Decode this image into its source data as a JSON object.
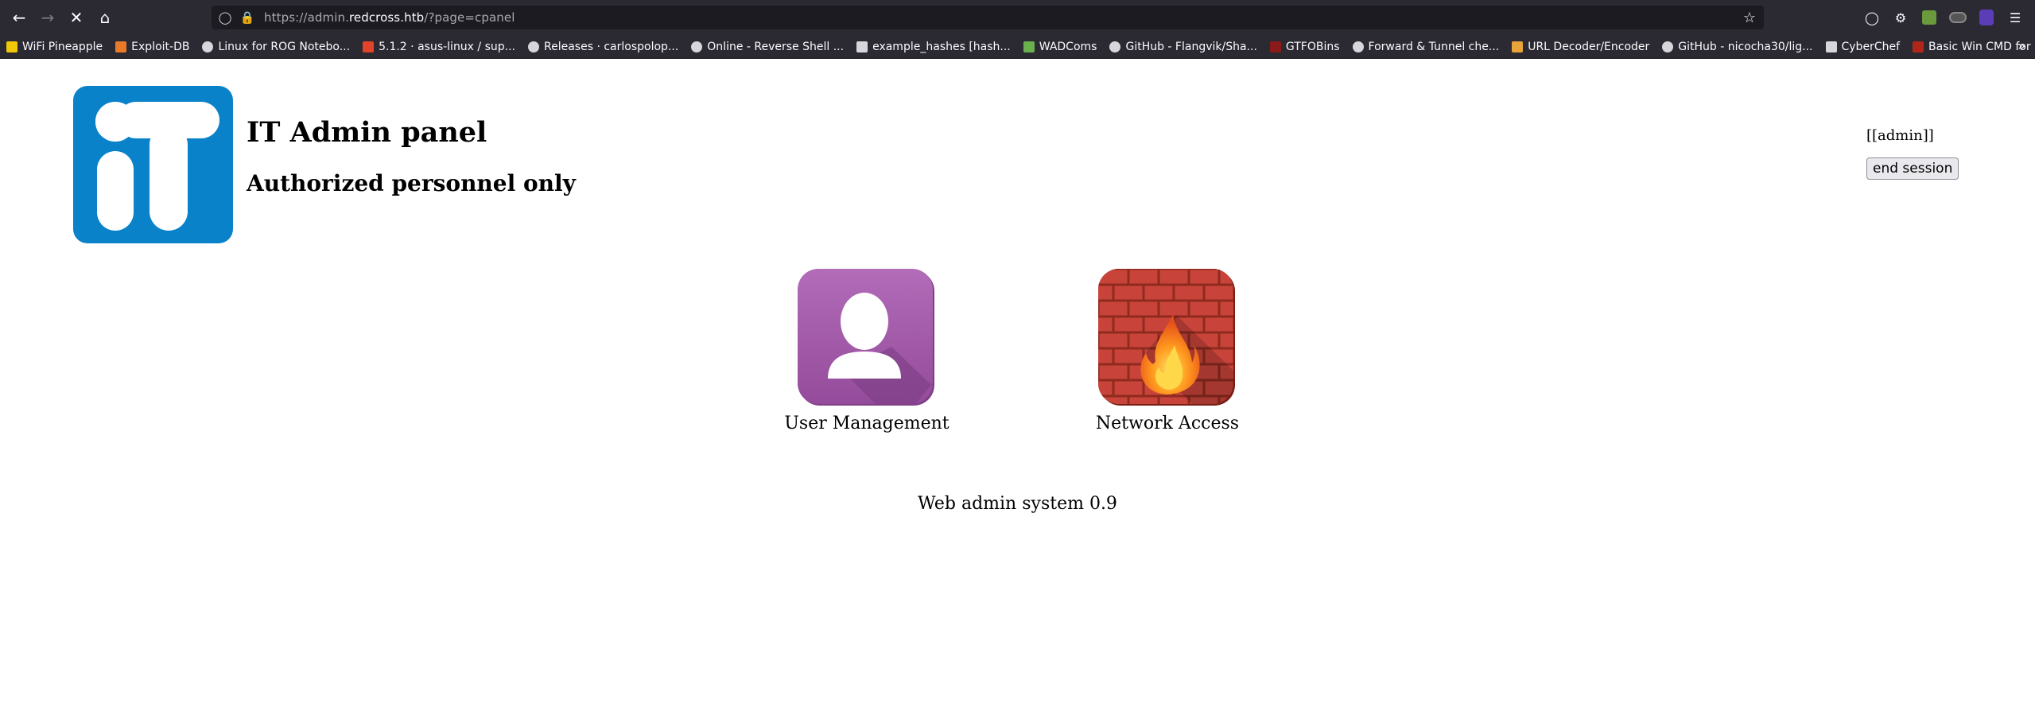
{
  "browser": {
    "url_host_prefix": "https://admin.",
    "url_host": "redcross.htb",
    "url_path": "/?page=cpanel",
    "bookmarks": [
      {
        "label": "WiFi Pineapple",
        "icon": "pineapple-icon",
        "color": "#f0c808"
      },
      {
        "label": "Exploit-DB",
        "icon": "exploitdb-icon",
        "color": "#e87a2a"
      },
      {
        "label": "Linux for ROG Notebo...",
        "icon": "globe-icon",
        "color": "#d7d7db"
      },
      {
        "label": "5.1.2 · asus-linux / sup...",
        "icon": "gitlab-icon",
        "color": "#e24329"
      },
      {
        "label": "Releases · carlospolop...",
        "icon": "github-icon",
        "color": "#d7d7db"
      },
      {
        "label": "Online - Reverse Shell ...",
        "icon": "skull-icon",
        "color": "#d7d7db"
      },
      {
        "label": "example_hashes [hash...",
        "icon": "hashcat-icon",
        "color": "#d7d7db"
      },
      {
        "label": "WADComs",
        "icon": "wadcoms-icon",
        "color": "#6ab04c"
      },
      {
        "label": "GitHub - Flangvik/Sha...",
        "icon": "github-icon",
        "color": "#d7d7db"
      },
      {
        "label": "GTFOBins",
        "icon": "gtfobins-icon",
        "color": "#8b1a1a"
      },
      {
        "label": "Forward & Tunnel che...",
        "icon": "github-icon",
        "color": "#d7d7db"
      },
      {
        "label": "URL Decoder/Encoder",
        "icon": "urldecoder-icon",
        "color": "#e8a33a"
      },
      {
        "label": "GitHub - nicocha30/lig...",
        "icon": "github-icon",
        "color": "#d7d7db"
      },
      {
        "label": "CyberChef",
        "icon": "chef-icon",
        "color": "#d7d7db"
      },
      {
        "label": "Basic Win CMD for Pe...",
        "icon": "cmd-icon",
        "color": "#b0271a"
      }
    ]
  },
  "page": {
    "title": "IT Admin panel",
    "subtitle": "Authorized personnel only",
    "user": "[[admin]]",
    "end_session": "end session",
    "apps": [
      {
        "label": "User Management",
        "icon": "user-icon",
        "color": "#a259a8"
      },
      {
        "label": "Network Access",
        "icon": "firewall-icon",
        "color": "#c0392b"
      }
    ],
    "footer": "Web admin system 0.9",
    "logo_color": "#0a82c9"
  }
}
